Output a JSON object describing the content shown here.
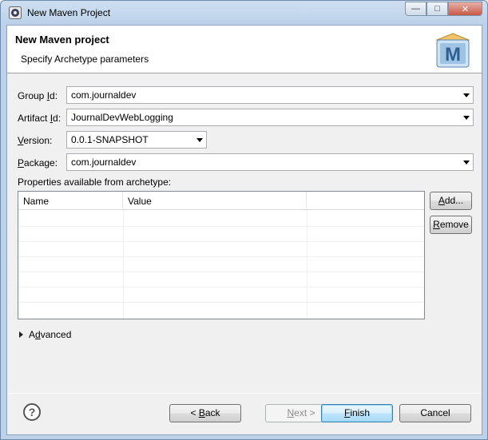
{
  "window": {
    "title": "New Maven Project",
    "minimize_glyph": "—",
    "maximize_glyph": "□",
    "close_glyph": "✕"
  },
  "header": {
    "title": "New Maven project",
    "subtitle": "Specify Archetype parameters",
    "logo_letter": "M"
  },
  "form": {
    "group_id": {
      "label_pre": "Group ",
      "label_mn": "I",
      "label_post": "d:",
      "value": "com.journaldev"
    },
    "artifact_id": {
      "label_pre": "Artifact ",
      "label_mn": "I",
      "label_post": "d:",
      "value": "JournalDevWebLogging"
    },
    "version": {
      "label_pre": "",
      "label_mn": "V",
      "label_post": "ersion:",
      "value": "0.0.1-SNAPSHOT"
    },
    "package": {
      "label_pre": "",
      "label_mn": "P",
      "label_post": "ackage:",
      "value": "com.journaldev"
    }
  },
  "properties": {
    "label": "Properties available from archetype:",
    "columns": [
      "Name",
      "Value"
    ],
    "rows": []
  },
  "buttons": {
    "add": {
      "mn": "A",
      "rest": "dd..."
    },
    "remove": {
      "mn": "R",
      "rest": "emove"
    },
    "back": {
      "pre": "< ",
      "mn": "B",
      "rest": "ack"
    },
    "next": {
      "pre": "",
      "mn": "N",
      "rest": "ext >"
    },
    "finish": {
      "pre": "",
      "mn": "F",
      "rest": "inish"
    },
    "cancel": "Cancel"
  },
  "advanced": {
    "pre": "A",
    "mn": "d",
    "rest": "vanced"
  },
  "help_glyph": "?",
  "colors": {
    "window_frame": "#bcd2ea",
    "dialog_bg": "#f0f0f0",
    "default_button": "#3c7fb1"
  }
}
